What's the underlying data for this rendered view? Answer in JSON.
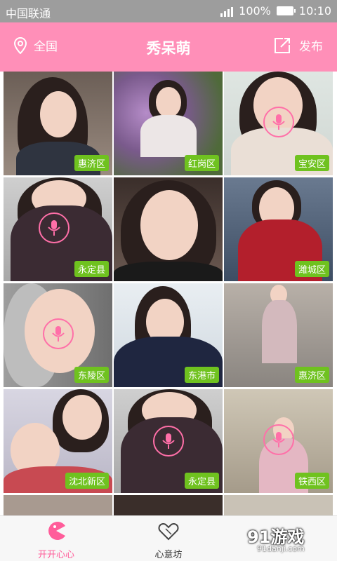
{
  "status": {
    "carrier": "中国联通",
    "battery": "100%",
    "time": "10:10"
  },
  "header": {
    "location_label": "全国",
    "title": "秀呆萌",
    "publish_label": "发布"
  },
  "tiles": [
    {
      "tag": "惠济区",
      "voice": false
    },
    {
      "tag": "红岗区",
      "voice": false
    },
    {
      "tag": "宝安区",
      "voice": true
    },
    {
      "tag": "永定县",
      "voice": true
    },
    {
      "tag": "",
      "voice": false
    },
    {
      "tag": "潍城区",
      "voice": false
    },
    {
      "tag": "东陵区",
      "voice": true
    },
    {
      "tag": "东港市",
      "voice": false
    },
    {
      "tag": "惠济区",
      "voice": false
    },
    {
      "tag": "沈北新区",
      "voice": false
    },
    {
      "tag": "永定县",
      "voice": true
    },
    {
      "tag": "铁西区",
      "voice": true
    }
  ],
  "nav": {
    "home_label": "开开心心",
    "square_label": "心意坊"
  },
  "watermark": {
    "brand": "91游戏",
    "url": "91danji.com"
  },
  "colors": {
    "header": "#ff8fb8",
    "tag": "#6fc21f",
    "active_nav": "#ff5d9a"
  }
}
